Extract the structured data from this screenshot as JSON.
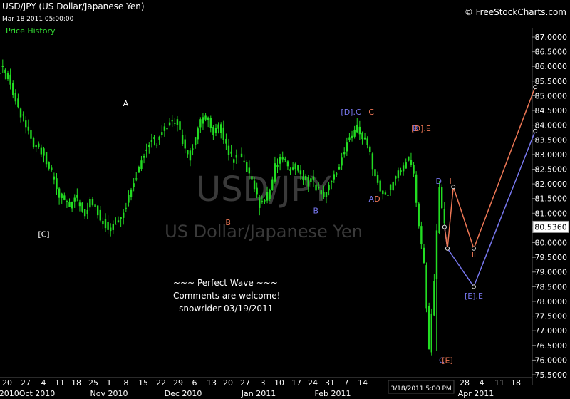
{
  "header": {
    "title": "USD/JPY (US Dollar/Japanese Yen)",
    "date": "Mar 18 2011 05:00:00",
    "brand": "© FreeStockCharts.com",
    "section": "Price History"
  },
  "watermark": {
    "symbol": "USD/JPY",
    "name": "US Dollar/Japanese Yen"
  },
  "annotation": {
    "lines": [
      "~~~ Perfect Wave ~~~",
      "Comments are welcome!",
      "- snowrider  03/19/2011"
    ]
  },
  "last_price_label": "80.5360",
  "cursor_date_label": "3/18/2011 5:00 PM",
  "colors": {
    "background": "#000000",
    "candle": "#22dd22",
    "wave_blue": "#7777ee",
    "wave_orange": "#ee7755",
    "white_label": "#ffffff",
    "green_text": "#33dd33"
  },
  "chart_data": {
    "type": "candlestick",
    "title": "USD/JPY (US Dollar/Japanese Yen)",
    "ylim": [
      75.5,
      87.2
    ],
    "y_ticks": [
      "87.0000",
      "86.5000",
      "86.0000",
      "85.5000",
      "85.0000",
      "84.5000",
      "84.0000",
      "83.5000",
      "83.0000",
      "82.5000",
      "82.0000",
      "81.5000",
      "81.0000",
      "80.5000",
      "80.0000",
      "79.5000",
      "79.0000",
      "78.5000",
      "78.0000",
      "77.5000",
      "77.0000",
      "76.5000",
      "76.0000",
      "75.5000"
    ],
    "x_ticks": [
      "20",
      "27",
      "4",
      "11",
      "18",
      "25",
      "1",
      "8",
      "15",
      "22",
      "29",
      "6",
      "13",
      "20",
      "27",
      "3",
      "10",
      "17",
      "24",
      "31",
      "7",
      "14",
      "28",
      "4",
      "11",
      "18"
    ],
    "month_labels": [
      "2010Oct 2010",
      "Nov 2010",
      "Dec 2010",
      "Jan 2011",
      "Feb 2011",
      "Apr 2011"
    ],
    "price_series": [
      [
        0,
        85.9
      ],
      [
        1,
        85.6
      ],
      [
        2,
        85.1
      ],
      [
        3,
        84.5
      ],
      [
        4,
        84.2
      ],
      [
        5,
        83.7
      ],
      [
        6,
        83.3
      ],
      [
        7,
        83.2
      ],
      [
        8,
        83.0
      ],
      [
        9,
        82.6
      ],
      [
        10,
        82.1
      ],
      [
        11,
        81.6
      ],
      [
        12,
        81.5
      ],
      [
        13,
        81.2
      ],
      [
        14,
        81.6
      ],
      [
        15,
        81.3
      ],
      [
        16,
        81.0
      ],
      [
        17,
        81.4
      ],
      [
        18,
        81.2
      ],
      [
        19,
        80.8
      ],
      [
        20,
        80.6
      ],
      [
        21,
        80.5
      ],
      [
        22,
        80.7
      ],
      [
        23,
        80.9
      ],
      [
        24,
        81.3
      ],
      [
        25,
        81.9
      ],
      [
        26,
        82.3
      ],
      [
        27,
        82.9
      ],
      [
        28,
        83.2
      ],
      [
        29,
        83.5
      ],
      [
        30,
        83.4
      ],
      [
        31,
        83.7
      ],
      [
        32,
        84.0
      ],
      [
        33,
        84.2
      ],
      [
        34,
        84.1
      ],
      [
        35,
        83.4
      ],
      [
        36,
        82.9
      ],
      [
        37,
        83.3
      ],
      [
        38,
        83.9
      ],
      [
        39,
        84.3
      ],
      [
        40,
        84.2
      ],
      [
        41,
        83.8
      ],
      [
        42,
        84.1
      ],
      [
        43,
        83.5
      ],
      [
        44,
        83.1
      ],
      [
        45,
        82.8
      ],
      [
        46,
        83.0
      ],
      [
        47,
        82.7
      ],
      [
        48,
        82.3
      ],
      [
        49,
        81.8
      ],
      [
        50,
        81.3
      ],
      [
        51,
        81.4
      ],
      [
        52,
        81.8
      ],
      [
        53,
        82.6
      ],
      [
        54,
        82.9
      ],
      [
        55,
        82.8
      ],
      [
        56,
        82.4
      ],
      [
        57,
        82.6
      ],
      [
        58,
        82.3
      ],
      [
        59,
        82.0
      ],
      [
        60,
        82.2
      ],
      [
        61,
        81.9
      ],
      [
        62,
        81.6
      ],
      [
        63,
        81.7
      ],
      [
        64,
        82.2
      ],
      [
        65,
        82.4
      ],
      [
        66,
        82.9
      ],
      [
        67,
        83.4
      ],
      [
        68,
        83.6
      ],
      [
        69,
        83.9
      ],
      [
        70,
        83.6
      ],
      [
        71,
        83.3
      ],
      [
        72,
        82.6
      ],
      [
        73,
        82.0
      ],
      [
        74,
        81.6
      ],
      [
        75,
        81.7
      ],
      [
        76,
        82.1
      ],
      [
        77,
        82.4
      ],
      [
        78,
        82.6
      ],
      [
        79,
        82.9
      ],
      [
        80,
        82.3
      ],
      [
        81,
        80.6
      ],
      [
        82,
        79.2
      ],
      [
        83,
        76.3
      ],
      [
        84,
        78.8
      ],
      [
        85,
        81.8
      ],
      [
        86,
        80.7
      ]
    ],
    "wave_projection_blue": [
      {
        "date": "3/18/2011",
        "price": 80.53
      },
      {
        "date": "3/19/2011",
        "price": 79.8
      },
      {
        "date": "3/28/2011",
        "price": 78.5
      },
      {
        "date": "4/18/2011",
        "price": 83.8
      }
    ],
    "wave_projection_orange": [
      {
        "date": "3/18/2011",
        "price": 80.53
      },
      {
        "date": "3/19/2011",
        "price": 79.8
      },
      {
        "date": "3/21/2011",
        "price": 81.9
      },
      {
        "date": "3/28/2011",
        "price": 79.8
      },
      {
        "date": "4/18/2011",
        "price": 85.3
      }
    ],
    "wave_labels": [
      {
        "text": "A",
        "color": "#ffffff",
        "date": "11/29/2010",
        "price": 84.65
      },
      {
        "text": "[C]",
        "color": "#ffffff",
        "date": "11/1/2010",
        "price": 80.2
      },
      {
        "text": "B",
        "color": "#ee7755",
        "date": "1/3/2011",
        "price": 80.6
      },
      {
        "text": "[D].C",
        "color": "#7777ee",
        "date": "2/14/2011",
        "price": 84.35
      },
      {
        "text": "C",
        "color": "#ee7755",
        "date": "2/21/2011",
        "price": 84.35
      },
      {
        "text": "B",
        "color": "#7777ee",
        "date": "2/2/2011",
        "price": 81.0
      },
      {
        "text": "A",
        "color": "#7777ee",
        "date": "2/21/2011",
        "price": 81.4
      },
      {
        "text": "D",
        "color": "#ee7755",
        "date": "2/23/2011",
        "price": 81.4
      },
      {
        "text": "B",
        "color": "#7777ee",
        "date": "3/8/2011",
        "price": 83.8
      },
      {
        "text": "[D].E",
        "color": "#ee7755",
        "date": "3/10/2011",
        "price": 83.8
      },
      {
        "text": "D",
        "color": "#7777ee",
        "date": "3/16/2011",
        "price": 82.0
      },
      {
        "text": "I",
        "color": "#ee7755",
        "date": "3/20/2011",
        "price": 82.0
      },
      {
        "text": "II",
        "color": "#ee7755",
        "date": "3/28/2011",
        "price": 79.5
      },
      {
        "text": "[E].E",
        "color": "#7777ee",
        "date": "3/28/2011",
        "price": 78.1
      },
      {
        "text": "C",
        "color": "#7777ee",
        "date": "3/17/2011",
        "price": 75.9
      },
      {
        "text": "[E]",
        "color": "#ee7755",
        "date": "3/19/2011",
        "price": 75.9
      }
    ]
  }
}
